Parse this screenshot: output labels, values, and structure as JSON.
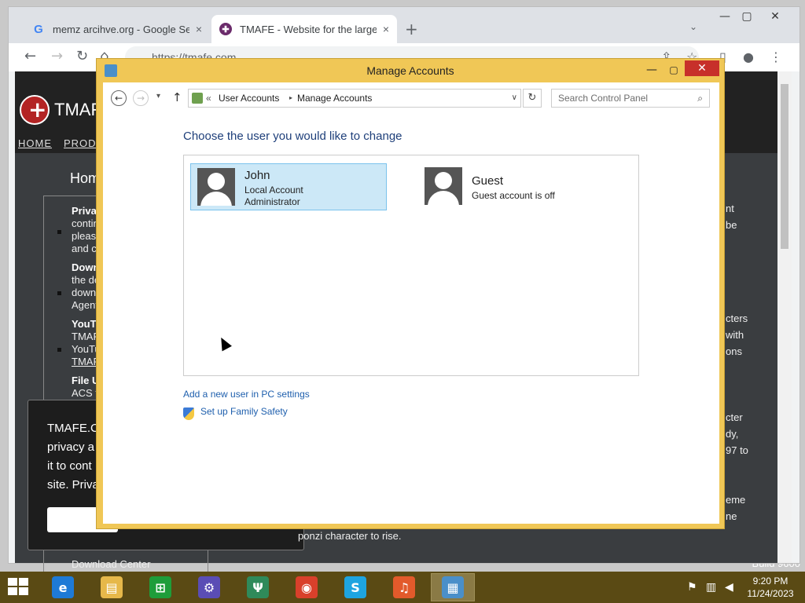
{
  "browser": {
    "tabs": [
      {
        "title": "memz arcihve.org - Google Search",
        "close": "×"
      },
      {
        "title": "TMAFE - Website for the largest",
        "close": "×"
      }
    ],
    "new_tab": "+",
    "tab_menu": "⌄",
    "window_buttons": {
      "minimize": "—",
      "maximize": "▢",
      "close": "✕"
    },
    "nav": {
      "back": "←",
      "forward": "→",
      "reload": "↻",
      "home": "⌂"
    },
    "url": "https://tmafe.com",
    "toolbar_icons": {
      "share": "⇪",
      "star": "☆",
      "sidebar": "▯",
      "profile": "●",
      "menu": "⋮"
    }
  },
  "website": {
    "name": "TMAF",
    "nav": [
      "HOME",
      "PRODU"
    ],
    "home_heading": "Hom",
    "left_items": [
      {
        "title": "Priva",
        "lines": [
          "contin",
          "please",
          "and c"
        ]
      },
      {
        "title": "Down",
        "lines": [
          "the de",
          "down",
          "Agent"
        ]
      },
      {
        "title": "YouTu",
        "lines": [
          "TMAF",
          "YouTu",
          "TMAF"
        ]
      },
      {
        "title": "File U",
        "lines": [
          "ACS f"
        ]
      }
    ],
    "right_fragments": [
      "nt\nbe",
      "cters\nwith\nons",
      "cter\ndy,\n97 to",
      "eme\nne"
    ],
    "cookie_text": "TMAFE.C\nprivacy a\nit to cont\nsite. Priva",
    "ponzi_text": "ponzi character to rise.",
    "download_center": "Download Center"
  },
  "manage_accounts": {
    "title": "Manage Accounts",
    "window_buttons": {
      "minimize": "—",
      "maximize": "▢",
      "close": "✕"
    },
    "nav": {
      "back": "←",
      "forward": "→",
      "recent": "▾",
      "up": "↑"
    },
    "address": {
      "chevron": "«",
      "crumbs": [
        "User Accounts",
        "Manage Accounts"
      ],
      "separator": "▸",
      "dropdown": "∨"
    },
    "refresh": "↻",
    "search_placeholder": "Search Control Panel",
    "search_icon": "⌕",
    "heading": "Choose the user you would like to change",
    "accounts": [
      {
        "name": "John",
        "lines": [
          "Local Account",
          "Administrator"
        ],
        "selected": true
      },
      {
        "name": "Guest",
        "lines": [
          "Guest account is off"
        ],
        "selected": false
      }
    ],
    "links": {
      "add_user": "Add a new user in PC settings",
      "family_safety": "Set up Family Safety"
    }
  },
  "desktop": {
    "build_text": "Build 9600"
  },
  "taskbar": {
    "apps": [
      {
        "name": "Internet Explorer",
        "glyph": "e",
        "color": "#1e7ad6",
        "active": false
      },
      {
        "name": "File Explorer",
        "glyph": "▤",
        "color": "#e6b84a",
        "active": false
      },
      {
        "name": "Store",
        "glyph": "⊞",
        "color": "#1e9d3a",
        "active": false
      },
      {
        "name": "Settings",
        "glyph": "⚙",
        "color": "#5a4db5",
        "active": false
      },
      {
        "name": "Food & Drink",
        "glyph": "Ψ",
        "color": "#2f8a5a",
        "active": false
      },
      {
        "name": "Chrome",
        "glyph": "◉",
        "color": "#d9402b",
        "active": false
      },
      {
        "name": "Skype",
        "glyph": "S",
        "color": "#1ea4e0",
        "active": false
      },
      {
        "name": "Music",
        "glyph": "♫",
        "color": "#e25a2b",
        "active": false
      },
      {
        "name": "Control Panel",
        "glyph": "▦",
        "color": "#4a8fc9",
        "active": true
      }
    ],
    "tray": {
      "flag": "⚑",
      "network": "▥",
      "volume": "◀"
    },
    "time": "9:20 PM",
    "date": "11/24/2023"
  }
}
